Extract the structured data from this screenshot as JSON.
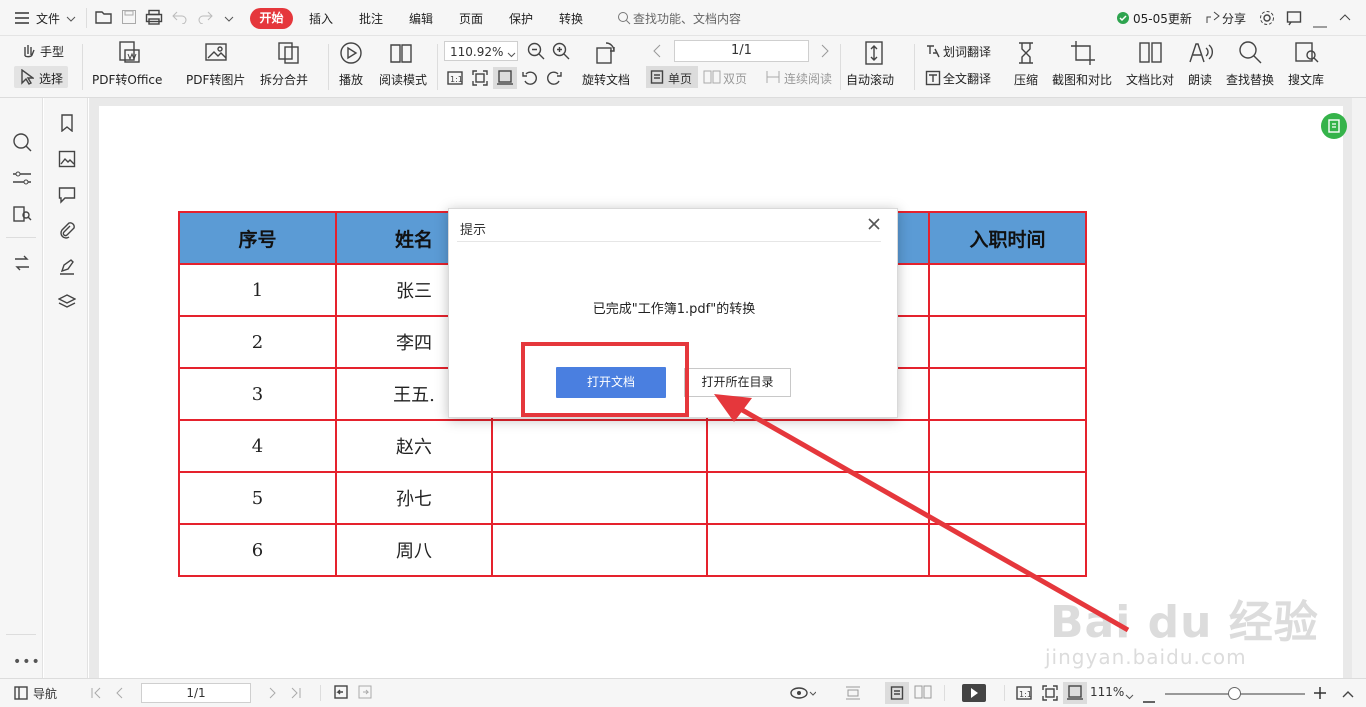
{
  "menubar": {
    "file": "文件",
    "tabs": [
      "开始",
      "插入",
      "批注",
      "编辑",
      "页面",
      "保护",
      "转换"
    ],
    "search_placeholder": "查找功能、文档内容",
    "update": "05-05更新",
    "share": "分享"
  },
  "toolbar": {
    "hand": "手型",
    "select": "选择",
    "pdf_to_office": "PDF转Office",
    "pdf_to_image": "PDF转图片",
    "split_merge": "拆分合并",
    "play": "播放",
    "read_mode": "阅读模式",
    "zoom": "110.92%",
    "page": "1/1",
    "rotate_doc": "旋转文档",
    "single_page": "单页",
    "double_page": "双页",
    "continuous": "连续阅读",
    "auto_scroll": "自动滚动",
    "word_translate": "划词翻译",
    "full_translate": "全文翻译",
    "compress": "压缩",
    "capture_compare": "截图和对比",
    "doc_compare": "文档比对",
    "read_aloud": "朗读",
    "find_replace": "查找替换",
    "search_library": "搜文库"
  },
  "table": {
    "headers": [
      "序号",
      "姓名",
      "",
      "",
      "入职时间"
    ],
    "rows": [
      [
        "1",
        "张三"
      ],
      [
        "2",
        "李四"
      ],
      [
        "3",
        "王五."
      ],
      [
        "4",
        "赵六"
      ],
      [
        "5",
        "孙七"
      ],
      [
        "6",
        "周八"
      ]
    ]
  },
  "dialog": {
    "title": "提示",
    "message": "已完成\"工作簿1.pdf\"的转换",
    "open_doc": "打开文档",
    "open_folder": "打开所在目录"
  },
  "statusbar": {
    "nav": "导航",
    "page": "1/1",
    "zoom": "111%"
  },
  "watermark": {
    "brand": "Bai du 经验",
    "url": "jingyan.baidu.com"
  },
  "colors": {
    "accent_red": "#e5373c",
    "header_blue": "#5b9bd5",
    "primary_button": "#4a7fe0"
  }
}
